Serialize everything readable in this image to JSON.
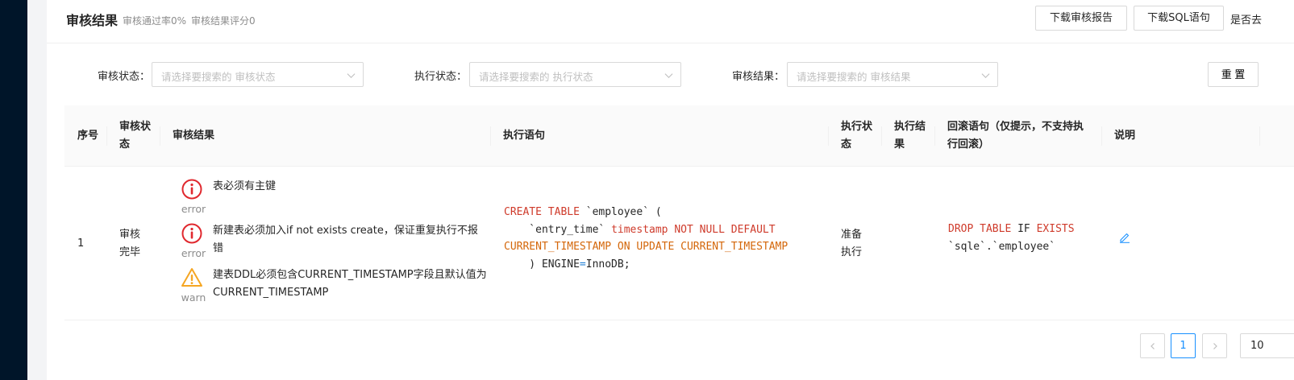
{
  "header": {
    "title": "审核结果",
    "pass_rate": "审核通过率0%",
    "score": "审核结果评分0",
    "download_report": "下载审核报告",
    "download_sql": "下载SQL语句",
    "truncated_text": "是否去"
  },
  "filters": [
    {
      "label": "审核状态：",
      "placeholder": "请选择要搜索的 审核状态"
    },
    {
      "label": "执行状态：",
      "placeholder": "请选择要搜索的 执行状态"
    },
    {
      "label": "审核结果：",
      "placeholder": "请选择要搜索的 审核结果"
    }
  ],
  "reset_label": "重 置",
  "table": {
    "columns": [
      "序号",
      "审核状态",
      "审核结果",
      "执行语句",
      "执行状态",
      "执行结果",
      "回滚语句（仅提示，不支持执行回滚）",
      "说明"
    ],
    "rows": [
      {
        "index": "1",
        "audit_status": "审核完毕",
        "results": [
          {
            "level": "error",
            "message": "表必须有主键"
          },
          {
            "level": "error",
            "message": "新建表必须加入if not exists create，保证重复执行不报错"
          },
          {
            "level": "warn",
            "message": "建表DDL必须包含CURRENT_TIMESTAMP字段且默认值为CURRENT_TIMESTAMP"
          }
        ],
        "sql": {
          "create_table": "CREATE TABLE",
          "table_name": " `employee` (",
          "column_name": "    `entry_time` ",
          "column_type": "timestamp NOT NULL DEFAULT",
          "ts_clause": "CURRENT_TIMESTAMP ON UPDATE CURRENT_TIMESTAMP",
          "close": "    ) ENGINE",
          "equals": "=",
          "engine": "InnoDB;"
        },
        "exec_status": "准备执行",
        "exec_result": "",
        "rollback": {
          "drop_table": "DROP TABLE",
          "if_kw": " IF ",
          "exists_kw": "EXISTS",
          "target": "`sqle`.`employee`"
        }
      }
    ]
  },
  "pagination": {
    "current_page": "1",
    "page_size_visible": "10"
  },
  "colors": {
    "error": "#e0282e",
    "warn": "#f5a623",
    "primary": "#1890ff",
    "keyword": "#cf3b2b"
  }
}
